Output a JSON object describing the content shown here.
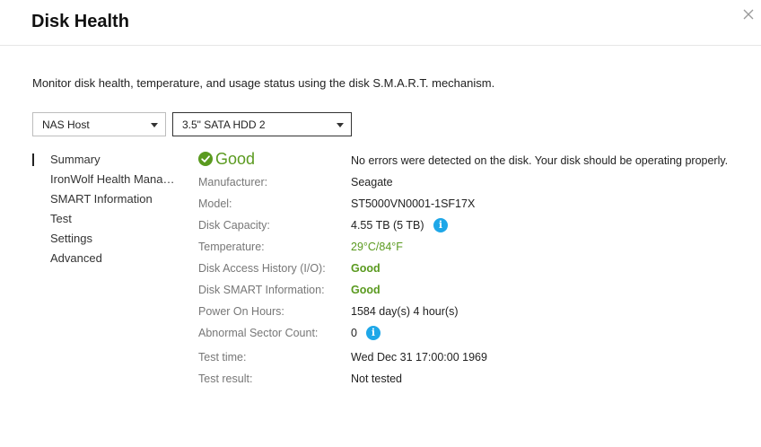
{
  "dialog": {
    "title": "Disk Health",
    "description": "Monitor disk health, temperature, and usage status using the disk S.M.A.R.T. mechanism."
  },
  "selectors": {
    "host": "NAS Host",
    "disk": "3.5\" SATA HDD 2"
  },
  "nav": {
    "items": [
      {
        "label": "Summary",
        "active": true
      },
      {
        "label": "IronWolf Health Management",
        "active": false
      },
      {
        "label": "SMART Information",
        "active": false
      },
      {
        "label": "Test",
        "active": false
      },
      {
        "label": "Settings",
        "active": false
      },
      {
        "label": "Advanced",
        "active": false
      }
    ]
  },
  "summary": {
    "status": "Good",
    "status_icon": "check-circle-icon",
    "status_color": "#5a9a1f",
    "message": "No errors were detected on the disk. Your disk should be operating properly.",
    "fields": {
      "manufacturer_label": "Manufacturer:",
      "manufacturer": "Seagate",
      "model_label": "Model:",
      "model": "ST5000VN0001-1SF17X",
      "capacity_label": "Disk Capacity:",
      "capacity": "4.55 TB (5 TB)",
      "temperature_label": "Temperature:",
      "temperature": "29°C/84°F",
      "access_history_label": "Disk Access History (I/O):",
      "access_history": "Good",
      "smart_label": "Disk SMART Information:",
      "smart": "Good",
      "power_on_label": "Power On Hours:",
      "power_on": "1584 day(s) 4 hour(s)",
      "sector_label": "Abnormal Sector Count:",
      "sector": "0",
      "test_time_label": "Test time:",
      "test_time": "Wed Dec 31 17:00:00 1969",
      "test_result_label": "Test result:",
      "test_result": "Not tested"
    },
    "info_icon": "i"
  }
}
